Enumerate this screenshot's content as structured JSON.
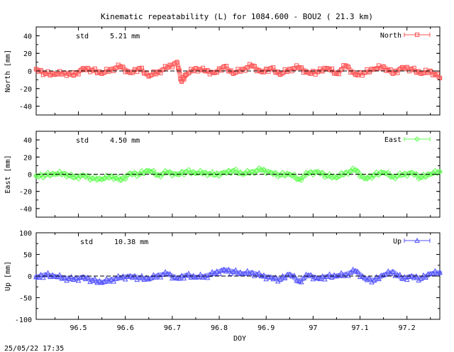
{
  "figure": {
    "title": "Kinematic repeatability (L) for 1084.600 - BOU2  ( 21.3 km)",
    "timestamp": "25/05/22 17:35",
    "xlabel": "DOY"
  },
  "chart_data": [
    {
      "type": "scatter",
      "title": "Kinematic repeatability (L) for 1084.600 - BOU2  ( 21.3 km)",
      "ylabel": "North [mm]",
      "xlabel": "",
      "xlim": [
        96.41,
        97.27
      ],
      "ylim": [
        -50,
        50
      ],
      "yticks": [
        -40,
        -20,
        0,
        20,
        40
      ],
      "xticks": [
        96.5,
        96.6,
        96.7,
        96.8,
        96.9,
        97.0,
        97.1,
        97.2
      ],
      "xtick_labels": [
        "96.5",
        "96.6",
        "96.7",
        "96.8",
        "96.9",
        "97",
        "97.1",
        "97.2"
      ],
      "show_xtick_labels": false,
      "grid": false,
      "legend_position": "top-right",
      "std_label": "std",
      "std_value": "5.21 mm",
      "series": [
        {
          "name": "North",
          "color": "#ff5050",
          "marker": "square",
          "x": [
            96.41,
            96.43,
            96.45,
            96.47,
            96.49,
            96.51,
            96.53,
            96.55,
            96.57,
            96.59,
            96.61,
            96.63,
            96.65,
            96.67,
            96.69,
            96.71,
            96.72,
            96.73,
            96.75,
            96.77,
            96.79,
            96.81,
            96.83,
            96.85,
            96.87,
            96.89,
            96.91,
            96.93,
            96.95,
            96.97,
            96.99,
            97.01,
            97.03,
            97.05,
            97.07,
            97.09,
            97.11,
            97.13,
            97.15,
            97.17,
            97.19,
            97.21,
            97.23,
            97.25,
            97.27
          ],
          "y": [
            2,
            -3,
            -4,
            -2,
            -5,
            3,
            1,
            -3,
            2,
            5,
            -2,
            3,
            -6,
            -1,
            4,
            10,
            -12,
            -4,
            3,
            0,
            -2,
            5,
            -3,
            2,
            6,
            -1,
            3,
            -4,
            2,
            4,
            -2,
            -1,
            3,
            -3,
            6,
            -4,
            -2,
            2,
            5,
            -3,
            4,
            2,
            -3,
            0,
            -8
          ]
        }
      ]
    },
    {
      "type": "scatter",
      "ylabel": "East [mm]",
      "xlabel": "",
      "xlim": [
        96.41,
        97.27
      ],
      "ylim": [
        -50,
        50
      ],
      "yticks": [
        -40,
        -20,
        0,
        20,
        40
      ],
      "xticks": [
        96.5,
        96.6,
        96.7,
        96.8,
        96.9,
        97.0,
        97.1,
        97.2
      ],
      "xtick_labels": [
        "96.5",
        "96.6",
        "96.7",
        "96.8",
        "96.9",
        "97",
        "97.1",
        "97.2"
      ],
      "show_xtick_labels": false,
      "grid": false,
      "legend_position": "top-right",
      "std_label": "std",
      "std_value": "4.50 mm",
      "series": [
        {
          "name": "East",
          "color": "#60ff50",
          "marker": "diamond",
          "x": [
            96.41,
            96.43,
            96.45,
            96.47,
            96.49,
            96.51,
            96.53,
            96.55,
            96.57,
            96.59,
            96.61,
            96.63,
            96.65,
            96.67,
            96.69,
            96.71,
            96.73,
            96.75,
            96.77,
            96.79,
            96.81,
            96.83,
            96.85,
            96.87,
            96.89,
            96.91,
            96.93,
            96.95,
            96.97,
            96.99,
            97.01,
            97.03,
            97.05,
            97.07,
            97.09,
            97.11,
            97.13,
            97.15,
            97.17,
            97.19,
            97.21,
            97.23,
            97.25,
            97.27
          ],
          "y": [
            -2,
            -1,
            0,
            1,
            -4,
            -1,
            -5,
            -6,
            -2,
            -7,
            1,
            0,
            4,
            -1,
            2,
            0,
            3,
            1,
            2,
            -1,
            2,
            4,
            0,
            3,
            5,
            2,
            -1,
            0,
            -6,
            1,
            3,
            -2,
            -4,
            2,
            5,
            -5,
            -1,
            2,
            -3,
            -1,
            2,
            -4,
            0,
            3
          ]
        }
      ]
    },
    {
      "type": "scatter",
      "ylabel": "Up [mm]",
      "xlabel": "DOY",
      "xlim": [
        96.41,
        97.27
      ],
      "ylim": [
        -100,
        100
      ],
      "yticks": [
        -100,
        -50,
        0,
        50,
        100
      ],
      "xticks": [
        96.5,
        96.6,
        96.7,
        96.8,
        96.9,
        97.0,
        97.1,
        97.2
      ],
      "xtick_labels": [
        "96.5",
        "96.6",
        "96.7",
        "96.8",
        "96.9",
        "97",
        "97.1",
        "97.2"
      ],
      "show_xtick_labels": true,
      "grid": false,
      "legend_position": "top-right",
      "std_label": "std",
      "std_value": "10.38 mm",
      "series": [
        {
          "name": "Up",
          "color": "#5050ff",
          "marker": "triangle",
          "x": [
            96.41,
            96.43,
            96.45,
            96.47,
            96.49,
            96.51,
            96.53,
            96.55,
            96.57,
            96.59,
            96.61,
            96.63,
            96.65,
            96.67,
            96.69,
            96.71,
            96.73,
            96.75,
            96.77,
            96.79,
            96.81,
            96.83,
            96.85,
            96.87,
            96.89,
            96.91,
            96.93,
            96.95,
            96.97,
            96.99,
            97.01,
            97.03,
            97.05,
            97.07,
            97.09,
            97.11,
            97.13,
            97.15,
            97.17,
            97.19,
            97.21,
            97.23,
            97.25,
            97.27
          ],
          "y": [
            -2,
            3,
            -1,
            -4,
            -8,
            -2,
            -10,
            -15,
            -8,
            -4,
            0,
            -4,
            -7,
            2,
            5,
            -5,
            2,
            -3,
            0,
            6,
            15,
            10,
            5,
            8,
            0,
            -3,
            -8,
            4,
            -12,
            2,
            -5,
            -1,
            0,
            4,
            12,
            -5,
            -10,
            2,
            10,
            -6,
            0,
            -6,
            5,
            8
          ]
        }
      ]
    }
  ]
}
